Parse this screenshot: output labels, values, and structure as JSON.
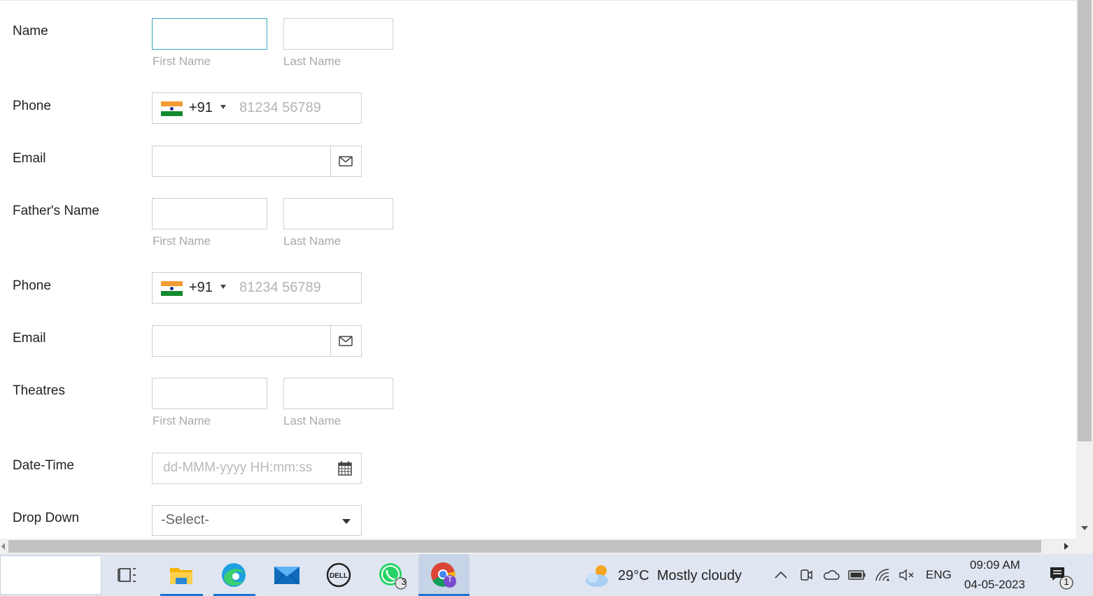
{
  "form": {
    "name": {
      "label": "Name",
      "first_sub": "First Name",
      "last_sub": "Last Name"
    },
    "phone1": {
      "label": "Phone",
      "code": "+91",
      "placeholder": "81234 56789"
    },
    "email1": {
      "label": "Email"
    },
    "father": {
      "label": "Father's Name",
      "first_sub": "First Name",
      "last_sub": "Last Name"
    },
    "phone2": {
      "label": "Phone",
      "code": "+91",
      "placeholder": "81234 56789"
    },
    "email2": {
      "label": "Email"
    },
    "theatres": {
      "label": "Theatres",
      "first_sub": "First Name",
      "last_sub": "Last Name"
    },
    "datetime": {
      "label": "Date-Time",
      "placeholder": "dd-MMM-yyyy HH:mm:ss"
    },
    "dropdown": {
      "label": "Drop Down",
      "selected": "-Select-"
    }
  },
  "taskbar": {
    "weather": {
      "temp": "29°C",
      "condition": "Mostly cloudy"
    },
    "whatsapp_badge": "3",
    "chrome_profile": "T",
    "language": "ENG",
    "time": "09:09 AM",
    "date": "04-05-2023",
    "notifications": "1"
  },
  "colors": {
    "focus_border": "#3aa7c2",
    "taskbar_bg": "#dfe6f1",
    "accent": "#1d74d0"
  }
}
